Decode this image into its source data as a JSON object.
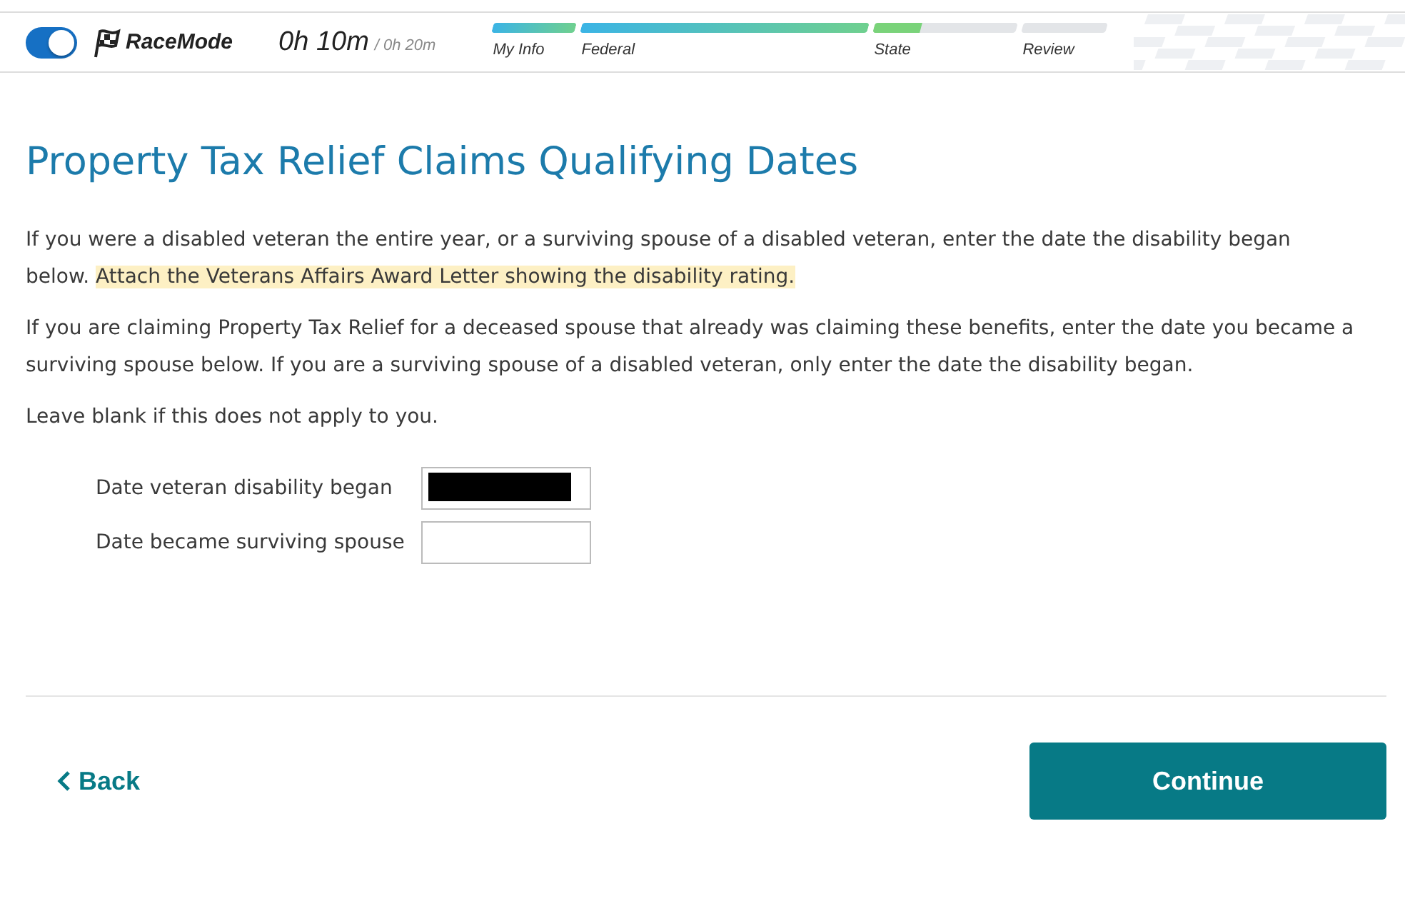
{
  "topbar": {
    "racemode_on": true,
    "brand": "RaceMode",
    "time_elapsed": "0h 10m",
    "time_total": "/ 0h 20m",
    "steps": [
      {
        "label": "My Info",
        "level": 1,
        "kind": "done"
      },
      {
        "label": "Federal",
        "level": 1,
        "kind": "done"
      },
      {
        "label": "State",
        "level": 0.33,
        "kind": "current"
      },
      {
        "label": "Review",
        "level": 0,
        "kind": "todo"
      }
    ]
  },
  "title": "Property Tax Relief Claims Qualifying Dates",
  "paragraphs": [
    {
      "text": "If you were a disabled veteran the entire year, or a surviving spouse of a disabled veteran, enter the date the disability began below. ",
      "highlight": "Attach the Veterans Affairs Award Letter showing the disability rating."
    },
    {
      "text": "If you are claiming Property Tax Relief for a deceased spouse that already was claiming these benefits, enter the date you became a surviving spouse below. If you are a surviving spouse of a disabled veteran, only enter the date the disability began."
    },
    {
      "text": "Leave blank if this does not apply to you."
    }
  ],
  "fields": [
    {
      "label": "Date veteran disability began",
      "redacted": true
    },
    {
      "label": "Date became surviving spouse",
      "redacted": false
    }
  ],
  "back": "Back",
  "continue": "Continue"
}
